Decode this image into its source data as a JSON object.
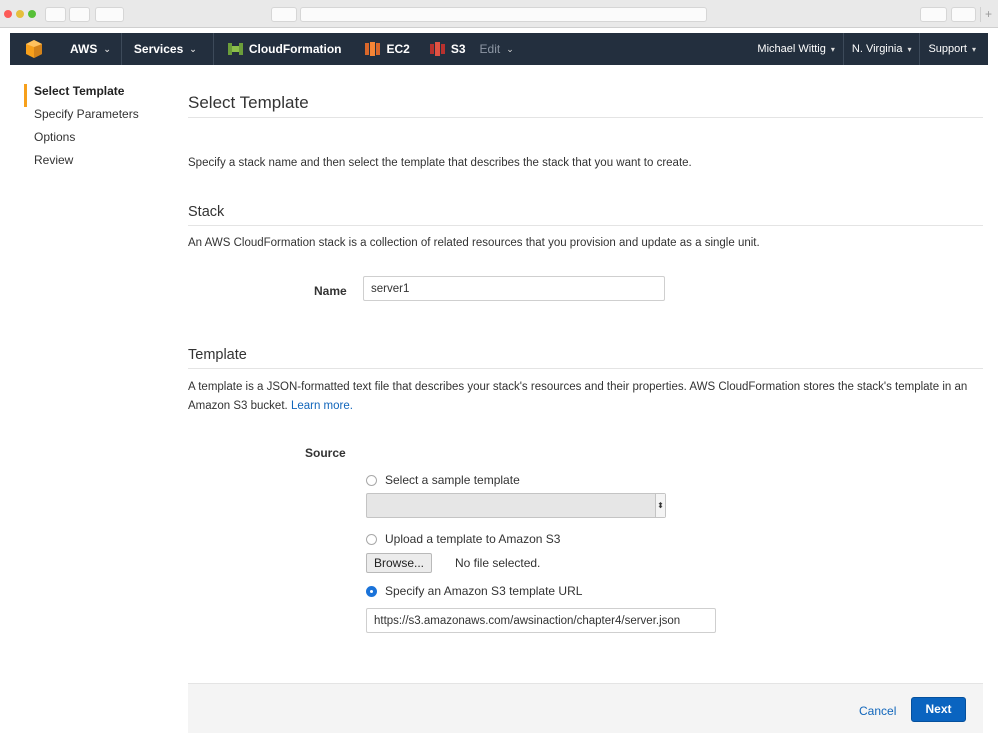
{
  "navbar": {
    "aws_label": "AWS",
    "services_label": "Services",
    "cloudformation_label": "CloudFormation",
    "ec2_label": "EC2",
    "s3_label": "S3",
    "edit_label": "Edit",
    "user_label": "Michael Wittig",
    "region_label": "N. Virginia",
    "support_label": "Support",
    "caret": "⌄",
    "dropdown_caret": "▾"
  },
  "sidebar": {
    "items": [
      {
        "label": "Select Template"
      },
      {
        "label": "Specify Parameters"
      },
      {
        "label": "Options"
      },
      {
        "label": "Review"
      }
    ]
  },
  "main": {
    "title": "Select Template",
    "intro": "Specify a stack name and then select the template that describes the stack that you want to create.",
    "stack": {
      "title": "Stack",
      "description": "An AWS CloudFormation stack is a collection of related resources that you provision and update as a single unit.",
      "name_label": "Name",
      "name_value": "server1"
    },
    "template": {
      "title": "Template",
      "description": "A template is a JSON-formatted text file that describes your stack's resources and their properties. AWS CloudFormation stores the stack's template in an Amazon S3 bucket.",
      "learn_more": "Learn more.",
      "source_label": "Source",
      "option_sample": "Select a sample template",
      "option_upload": "Upload a template to Amazon S3",
      "browse_label": "Browse...",
      "no_file_label": "No file selected.",
      "option_url": "Specify an Amazon S3 template URL",
      "url_value": "https://s3.amazonaws.com/awsinaction/chapter4/server.json",
      "selected_option": "url"
    }
  },
  "footer": {
    "cancel_label": "Cancel",
    "next_label": "Next"
  },
  "colors": {
    "navbar_bg": "#232f3e",
    "accent_orange": "#f7a01b",
    "primary_button": "#0a64c0",
    "link": "#1166bb"
  }
}
